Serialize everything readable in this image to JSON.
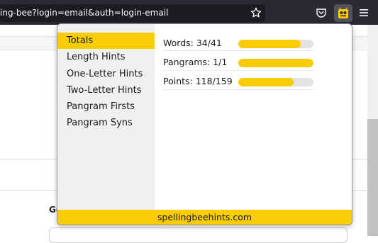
{
  "browser": {
    "url": "ing-bee?login=email&auth=login-email",
    "icons": [
      "star-icon",
      "pocket-icon",
      "bee-extension-icon",
      "hamburger-menu-icon"
    ]
  },
  "page": {
    "heading_fragment": "Ge"
  },
  "popup": {
    "nav": [
      {
        "label": "Totals",
        "active": true
      },
      {
        "label": "Length Hints",
        "active": false
      },
      {
        "label": "One-Letter Hints",
        "active": false
      },
      {
        "label": "Two-Letter Hints",
        "active": false
      },
      {
        "label": "Pangram Firsts",
        "active": false
      },
      {
        "label": "Pangram Syns",
        "active": false
      }
    ],
    "stats": [
      {
        "label": "Words: 34/41",
        "progress": 0.83
      },
      {
        "label": "Pangrams: 1/1",
        "progress": 1.0
      },
      {
        "label": "Points: 118/159",
        "progress": 0.74
      }
    ],
    "footer": "spellingbeehints.com"
  },
  "colors": {
    "accent": "#f8cd05",
    "toolbar": "#2b2a33",
    "urlbar": "#1c1b22",
    "nav_bg": "#f0f0f0",
    "track": "#e3e3e3"
  }
}
